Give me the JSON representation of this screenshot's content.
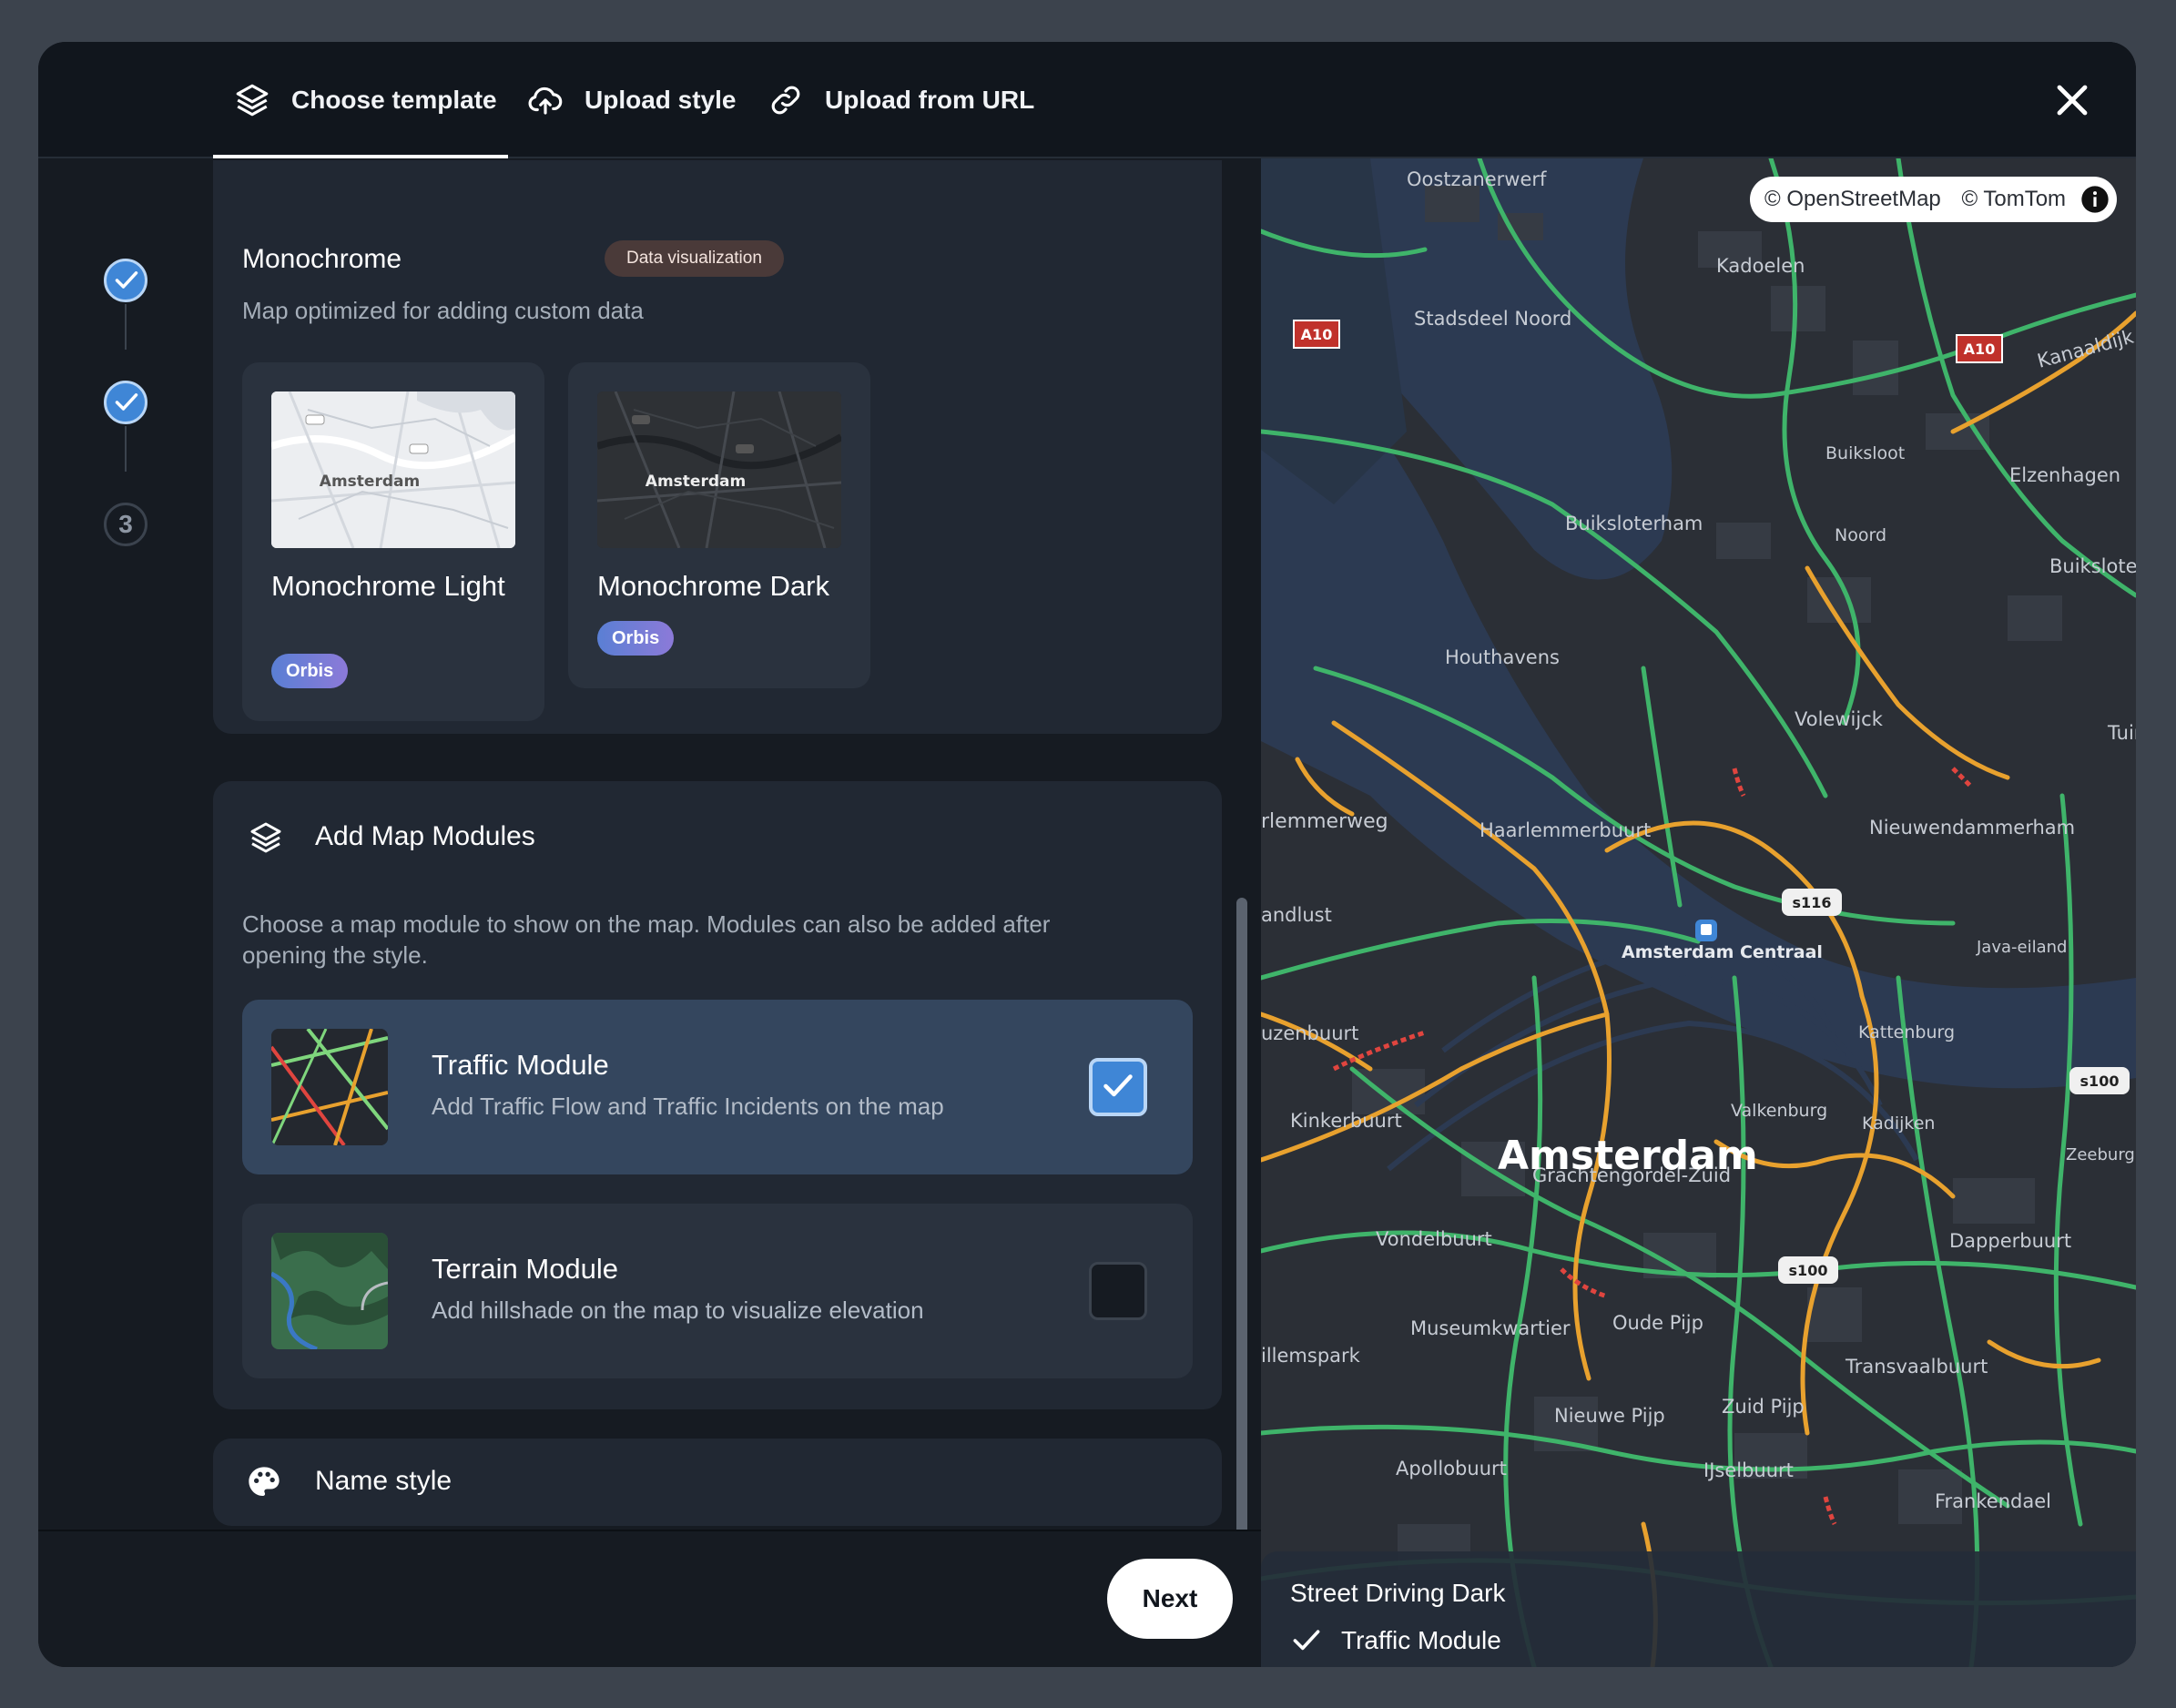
{
  "tabs": [
    {
      "label": "Choose template",
      "icon": "layers-icon",
      "active": true
    },
    {
      "label": "Upload style",
      "icon": "cloud-upload-icon",
      "active": false
    },
    {
      "label": "Upload from URL",
      "icon": "link-icon",
      "active": false
    }
  ],
  "stepper": {
    "steps": [
      {
        "state": "done"
      },
      {
        "state": "done"
      },
      {
        "state": "pending",
        "label": "3"
      }
    ]
  },
  "monochrome": {
    "title": "Monochrome",
    "badge": "Data visualization",
    "description": "Map optimized for adding custom data",
    "templates": [
      {
        "name": "Monochrome Light",
        "badge": "Orbis",
        "thumb_label": "Amsterdam",
        "theme": "light"
      },
      {
        "name": "Monochrome Dark",
        "badge": "Orbis",
        "thumb_label": "Amsterdam",
        "theme": "dark"
      }
    ]
  },
  "modules": {
    "title": "Add Map Modules",
    "description": "Choose a map module to show on the map. Modules can also be added after opening the style.",
    "items": [
      {
        "title": "Traffic Module",
        "description": "Add Traffic Flow and Traffic Incidents on the map",
        "checked": true
      },
      {
        "title": "Terrain Module",
        "description": "Add hillshade on the map to visualize elevation",
        "checked": false
      }
    ]
  },
  "name_style": {
    "title": "Name style",
    "icon": "palette-icon"
  },
  "footer": {
    "next_label": "Next"
  },
  "map": {
    "attribution": [
      "© OpenStreetMap",
      "© TomTom"
    ],
    "city_label": "Amsterdam",
    "labels": {
      "oostzanerwerf": "Oostzanerwerf",
      "kadoelen": "Kadoelen",
      "stadsdeel_noord": "Stadsdeel Noord",
      "kanaaldijk": "Kanaaldijk",
      "buiksloot": "Buiksloot",
      "elzenhagen": "Elzenhagen",
      "buiksloterham": "Buiksloterham",
      "noord": "Noord",
      "buiksloter": "Buiksloter",
      "houthavens": "Houthavens",
      "volewijck": "Volewijck",
      "tuin": "Tuin",
      "rlemmerweg": "rlemmerweg",
      "haarlemmerbuurt": "Haarlemmerbuurt",
      "nieuwendammerham": "Nieuwendammerham",
      "andlust": "andlust",
      "amsterdam_centraal": "Amsterdam Centraal",
      "java_eiland": "Java-eiland",
      "uzenbuurt": "uzenbuurt",
      "kattenburg": "Kattenburg",
      "kinkerbuurt": "Kinkerbuurt",
      "valkenburg": "Valkenburg",
      "kadijken": "Kadijken",
      "zeeburg": "Zeeburg",
      "grachtengordel_zuid": "Grachtengordel-Zuid",
      "vondelbuurt": "Vondelbuurt",
      "dapperbuurt": "Dapperbuurt",
      "museumkwartier": "Museumkwartier",
      "oude_pijp": "Oude Pijp",
      "illemspark": "illemspark",
      "transvaalbuurt": "Transvaalbuurt",
      "nieuwe_pijp": "Nieuwe Pijp",
      "zuid_pijp": "Zuid Pijp",
      "apollobuurt": "Apollobuurt",
      "ijselbuurt": "IJselbuurt",
      "frankendael": "Frankendael"
    },
    "shields": {
      "a10_left": "A10",
      "a10_right": "A10",
      "s116": "s116",
      "s100_right": "s100",
      "s100_center": "s100"
    },
    "colors": {
      "flow_good": "#3fb46a",
      "flow_slow": "#e8a12e",
      "flow_jam": "#e0453f",
      "water": "#2c3a52",
      "land": "#2b2f36"
    }
  },
  "legend": {
    "style_name": "Street Driving Dark",
    "module": "Traffic Module"
  },
  "colors": {
    "accent": "#3f86d6",
    "selected_row": "#34465e",
    "card": "#212833",
    "badge_dv_bg": "#4a3a39"
  }
}
